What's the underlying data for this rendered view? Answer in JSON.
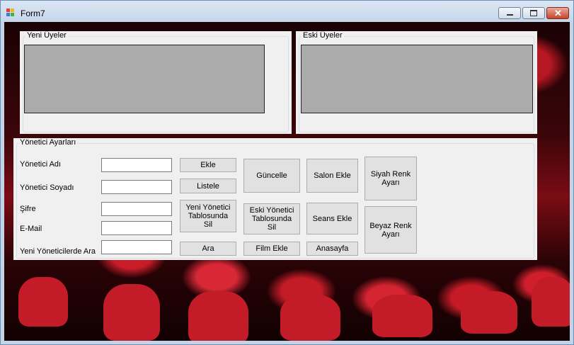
{
  "window": {
    "title": "Form7",
    "app_icon": "winforms-app-icon"
  },
  "titlebar_buttons": [
    "minimize-icon",
    "maximize-icon",
    "close-icon"
  ],
  "groups": {
    "new_members": {
      "title": "Yeni Üyeler"
    },
    "old_members": {
      "title": "Eski Üyeler"
    },
    "admin_settings": {
      "title": "Yönetici Ayarları"
    }
  },
  "labels": {
    "admin_name": "Yönetici Adı",
    "admin_surname": "Yönetici Soyadı",
    "password": "Şifre",
    "email": "E-Mail",
    "search_new_admins": "Yeni Yöneticilerde Ara"
  },
  "inputs": {
    "admin_name": "",
    "admin_surname": "",
    "password": "",
    "email": "",
    "search": ""
  },
  "buttons": {
    "add": "Ekle",
    "list": "Listele",
    "delete_new_admin_table": "Yeni Yönetici\nTablosunda\nSil",
    "search": "Ara",
    "update": "Güncelle",
    "delete_old_admin_table": "Eski Yönetici\nTablosunda\nSil",
    "add_film": "Film Ekle",
    "add_hall": "Salon Ekle",
    "add_session": "Seans Ekle",
    "home": "Anasayfa",
    "black_color": "Siyah Renk\nAyarı",
    "white_color": "Beyaz Renk\nAyarı"
  }
}
